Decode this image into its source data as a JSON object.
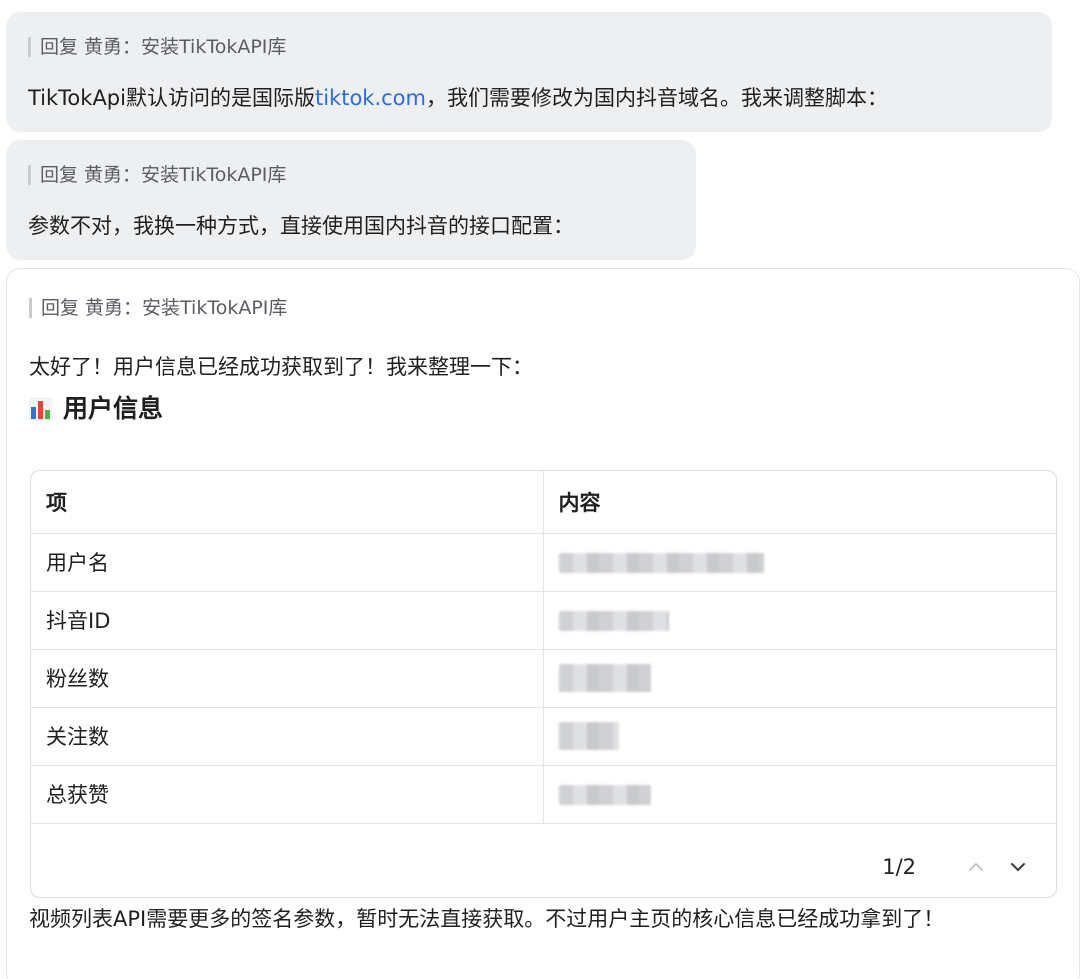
{
  "messages": [
    {
      "reply_label": "回复 黄勇：安装TikTokAPI库",
      "text_before_link": "TikTokApi默认访问的是国际版",
      "link": "tiktok.com",
      "text_after_link": "，我们需要修改为国内抖音域名。我来调整脚本："
    },
    {
      "reply_label": "回复 黄勇：安装TikTokAPI库",
      "text": "参数不对，我换一种方式，直接使用国内抖音的接口配置："
    }
  ],
  "card": {
    "reply_label": "回复 黄勇：安装TikTokAPI库",
    "intro": "太好了！用户信息已经成功获取到了！我来整理一下：",
    "heading_icon": "bar-chart-icon",
    "heading": "用户信息",
    "table": {
      "headers": [
        "项",
        "内容"
      ],
      "rows": [
        {
          "label": "用户名",
          "value": ""
        },
        {
          "label": "抖音ID",
          "value": ""
        },
        {
          "label": "粉丝数",
          "value": ""
        },
        {
          "label": "关注数",
          "value": ""
        },
        {
          "label": "总获赞",
          "value": ""
        }
      ]
    },
    "pager": {
      "page_text": "1/2",
      "prev_icon": "chevron-up-icon",
      "next_icon": "chevron-down-icon"
    },
    "outro": "视频列表API需要更多的签名参数，暂时无法直接获取。不过用户主页的核心信息已经成功拿到了！"
  }
}
